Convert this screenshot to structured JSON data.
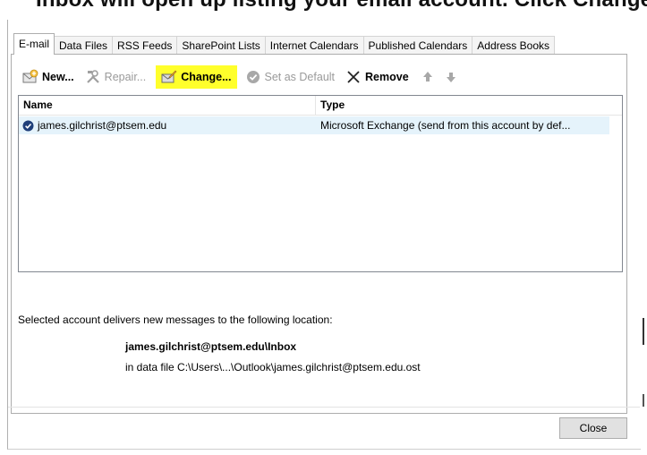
{
  "instruction_text": "Inbox will open up listing your email account. Click Change...",
  "tabs": [
    {
      "label": "E-mail",
      "active": true
    },
    {
      "label": "Data Files",
      "active": false
    },
    {
      "label": "RSS Feeds",
      "active": false
    },
    {
      "label": "SharePoint Lists",
      "active": false
    },
    {
      "label": "Internet Calendars",
      "active": false
    },
    {
      "label": "Published Calendars",
      "active": false
    },
    {
      "label": "Address Books",
      "active": false
    }
  ],
  "toolbar": {
    "new_label": "New...",
    "repair_label": "Repair...",
    "change_label": "Change...",
    "set_default_label": "Set as Default",
    "remove_label": "Remove",
    "highlight_color": "#ffff2b"
  },
  "list": {
    "columns": {
      "name": "Name",
      "type": "Type"
    },
    "rows": [
      {
        "name": "james.gilchrist@ptsem.edu",
        "type": "Microsoft Exchange (send from this account by def..."
      }
    ]
  },
  "delivery": {
    "label": "Selected account delivers new messages to the following location:",
    "path": "james.gilchrist@ptsem.edu\\Inbox",
    "file": "in data file C:\\Users\\...\\Outlook\\james.gilchrist@ptsem.edu.ost"
  },
  "buttons": {
    "close_label": "Close"
  }
}
